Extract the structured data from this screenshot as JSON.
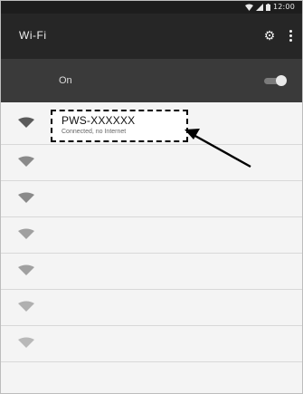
{
  "status_bar": {
    "time": "12:00"
  },
  "app_bar": {
    "title": "Wi-Fi"
  },
  "switch": {
    "label": "On",
    "state": "on"
  },
  "networks": [
    {
      "ssid": "PWS-XXXXXX",
      "status": "Connected, no Internet",
      "highlighted": true
    },
    {
      "ssid": "",
      "status": ""
    },
    {
      "ssid": "",
      "status": ""
    },
    {
      "ssid": "",
      "status": ""
    },
    {
      "ssid": "",
      "status": ""
    },
    {
      "ssid": "",
      "status": ""
    },
    {
      "ssid": "",
      "status": ""
    }
  ],
  "icons": {
    "status": [
      "wifi-signal-icon",
      "cell-signal-icon",
      "battery-icon"
    ],
    "settings": "gear-icon",
    "overflow": "more-vert-icon",
    "network": "wifi-icon",
    "annotation": "arrow-icon"
  },
  "colors": {
    "app_bar": "#262626",
    "switch_bar": "#3a3a3a",
    "list_background": "#f4f4f4",
    "highlight_border": "#000000"
  }
}
